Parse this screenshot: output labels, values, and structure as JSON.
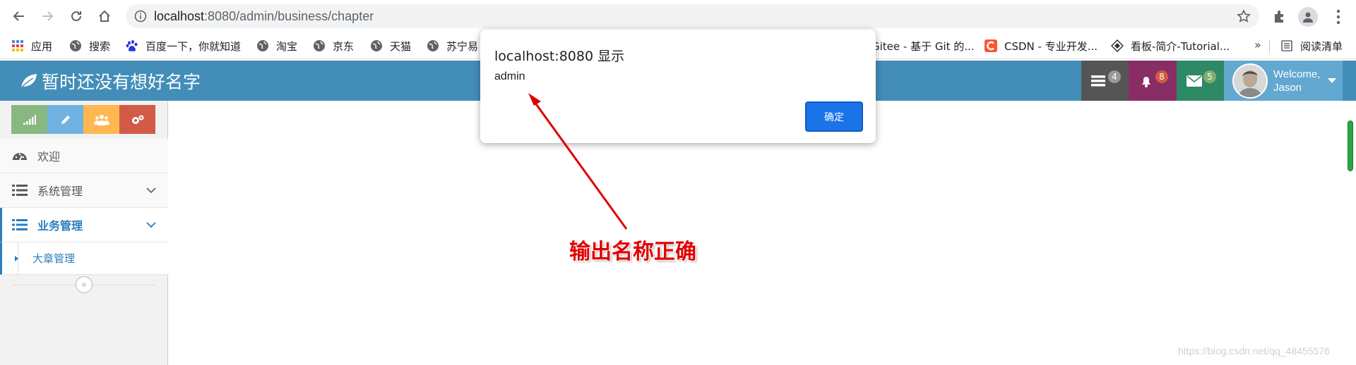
{
  "browser": {
    "url_host": "localhost",
    "url_rest": ":8080/admin/business/chapter"
  },
  "bookmarks": [
    {
      "label": "应用"
    },
    {
      "label": "搜索"
    },
    {
      "label": "百度一下，你就知道"
    },
    {
      "label": "淘宝"
    },
    {
      "label": "京东"
    },
    {
      "label": "天猫"
    },
    {
      "label": "苏宁易"
    },
    {
      "label": "Gitee - 基于 Git 的..."
    },
    {
      "label": "CSDN - 专业开发..."
    },
    {
      "label": "看板-简介-Tutorial..."
    }
  ],
  "bookmarks_more": "»",
  "reading_list": "阅读清单",
  "navbar": {
    "brand": "暂时还没有想好名字",
    "badges": {
      "tasks": "4",
      "notifications": "8",
      "messages": "5"
    },
    "welcome_line1": "Welcome,",
    "welcome_line2": "Jason"
  },
  "sidebar": {
    "shortcut_colors": [
      "#87b87f",
      "#6fb3e0",
      "#ffb752",
      "#d15b47"
    ],
    "items": [
      {
        "label": "欢迎"
      },
      {
        "label": "系统管理"
      },
      {
        "label": "业务管理"
      }
    ],
    "submenu": {
      "label": "大章管理"
    },
    "collapse_glyph": "«"
  },
  "dialog": {
    "title": "localhost:8080 显示",
    "message": "admin",
    "ok_label": "确定"
  },
  "annotation": "输出名称正确",
  "watermark": "https://blog.csdn.net/qq_48455576",
  "colors": {
    "navbar": "#438eb9",
    "user_area": "#62a8d1",
    "tasks_bg": "#555555",
    "notifications_bg": "#892e65",
    "messages_bg": "#2e8965",
    "accent": "#2b7dbc",
    "dialog_button": "#1a73e8"
  }
}
